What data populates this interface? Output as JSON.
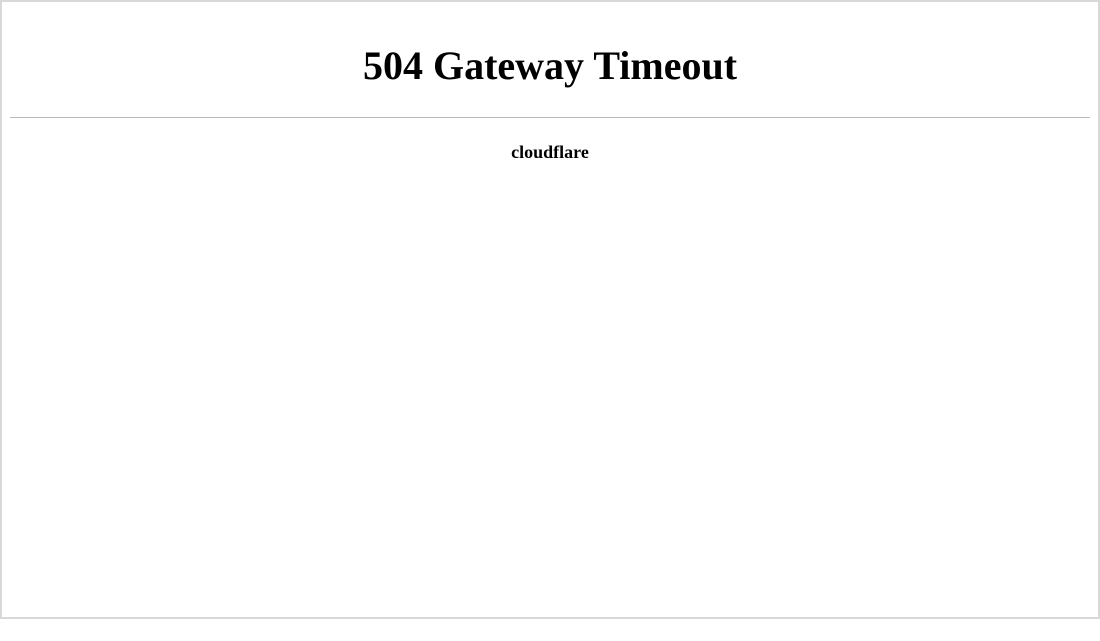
{
  "error": {
    "heading": "504 Gateway Timeout",
    "provider": "cloudflare"
  }
}
